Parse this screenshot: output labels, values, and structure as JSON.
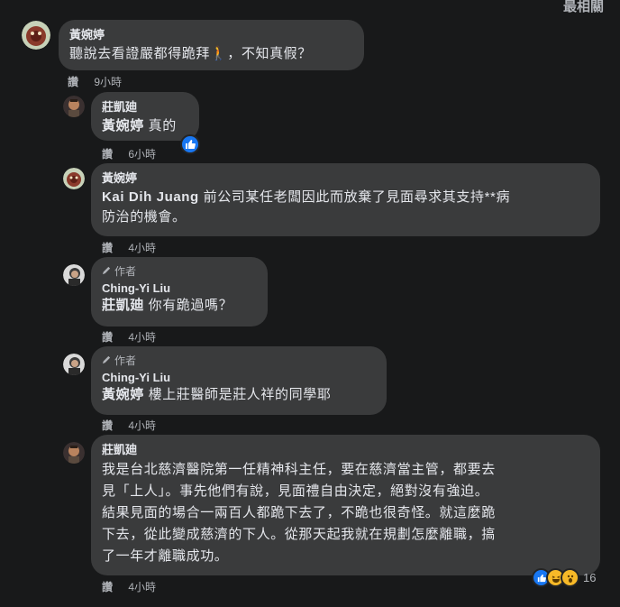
{
  "sort_label": "最相關",
  "comments": [
    {
      "author": "黃婉婷",
      "text": "聽說去看證嚴都得跪拜🚶，不知真假？",
      "reply_label": "讚",
      "time": "9小時"
    },
    {
      "author": "莊凱廸",
      "mention": "黃婉婷",
      "text": "真的",
      "reply_label": "讚",
      "time": "6小時",
      "reaction": "like-icon"
    },
    {
      "author": "黃婉婷",
      "mention": "Kai Dih Juang",
      "text_line1": "前公司某任老闆因此而放棄了見面尋求其支持**病",
      "text_line2": "防治的機會。",
      "reply_label": "讚",
      "time": "4小時"
    },
    {
      "badge": "作者",
      "author": "Ching-Yi Liu",
      "mention": "莊凱廸",
      "text": "你有跪過嗎？",
      "reply_label": "讚",
      "time": "4小時"
    },
    {
      "badge": "作者",
      "author": "Ching-Yi Liu",
      "mention": "黃婉婷",
      "text": "樓上莊醫師是莊人祥的同學耶",
      "reply_label": "讚",
      "time": "4小時"
    },
    {
      "author": "莊凱廸",
      "lines": [
        "我是台北慈濟醫院第一任精神科主任，要在慈濟當主管，都要去",
        "見「上人」。事先他們有說，見面禮自由決定，絕對沒有強迫。",
        "結果見面的場合一兩百人都跪下去了，不跪也很奇怪。就這麼跪",
        "下去，從此變成慈濟的下人。從那天起我就在規劃怎麼離職，搞",
        "了一年才離職成功。"
      ],
      "reply_label": "讚",
      "time": "4小時",
      "reaction_count": "16",
      "reactions": [
        "like-icon",
        "haha-icon",
        "wow-icon"
      ]
    }
  ],
  "colors": {
    "background": "#18191a",
    "bubble": "#3a3b3c",
    "text": "#e4e6eb",
    "secondary": "#b0b3b8",
    "like": "#1877f2"
  }
}
